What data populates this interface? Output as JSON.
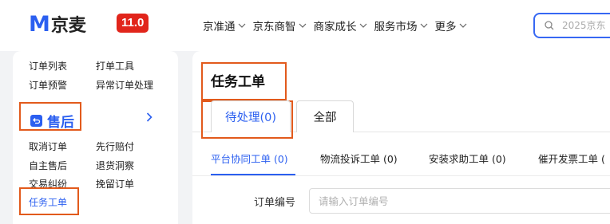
{
  "header": {
    "logo_letter": "M",
    "logo_text": "京麦",
    "version": "11.0",
    "nav": [
      {
        "label": "京准通"
      },
      {
        "label": "京东商智"
      },
      {
        "label": "商家成长"
      },
      {
        "label": "服务市场"
      },
      {
        "label": "更多"
      }
    ],
    "search_placeholder": "2025京东"
  },
  "sidebar": {
    "order_group": {
      "items": [
        "订单列表",
        "打单工具",
        "订单预警",
        "异常订单处理"
      ]
    },
    "aftersale": {
      "title": "售后",
      "items": [
        "取消订单",
        "先行赔付",
        "自主售后",
        "退货洞察",
        "交易纠纷",
        "挽留订单",
        "任务工单"
      ]
    }
  },
  "main": {
    "title": "任务工单",
    "tabs": [
      {
        "label": "待处理(0)",
        "active": true
      },
      {
        "label": "全部",
        "active": false
      }
    ],
    "subtabs": [
      {
        "label": "平台协同工单 (0)",
        "active": true
      },
      {
        "label": "物流投诉工单 (0)",
        "active": false
      },
      {
        "label": "安装求助工单 (0)",
        "active": false
      },
      {
        "label": "催开发票工单 (",
        "active": false
      }
    ],
    "filter": {
      "label": "订单编号",
      "placeholder": "请输入订单编号"
    }
  },
  "colors": {
    "brand_red": "#e1251b",
    "brand_blue": "#2b5ff0",
    "highlight_orange": "#e25a1c"
  }
}
